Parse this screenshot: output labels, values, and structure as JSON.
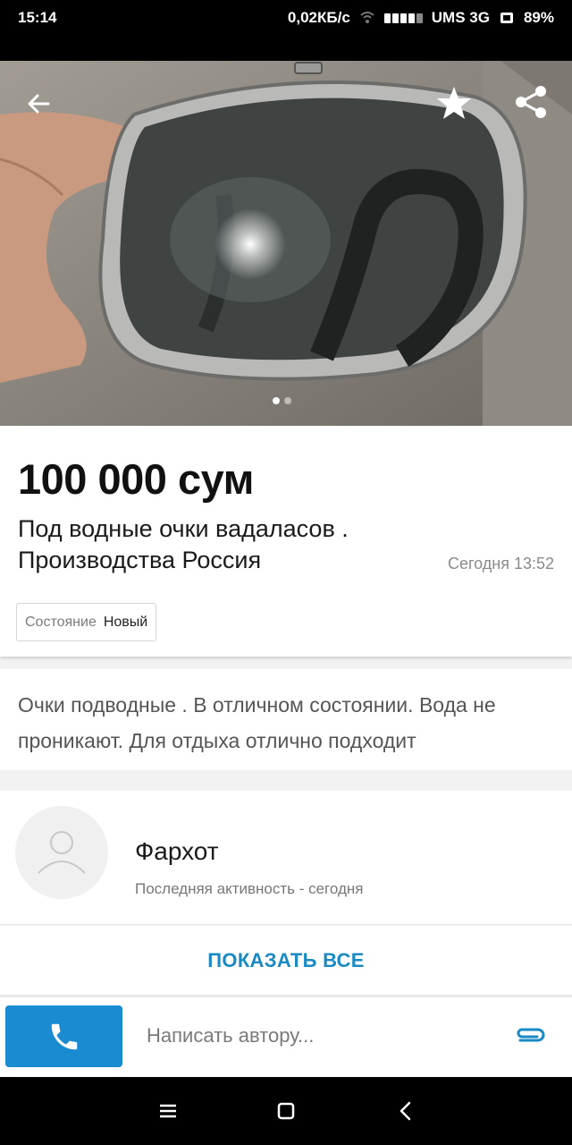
{
  "status_bar": {
    "time": "15:14",
    "speed": "0,02КБ/с",
    "carrier": "UMS 3G",
    "battery": "89%"
  },
  "photo": {
    "slide_count": 2,
    "active_slide": 1
  },
  "listing": {
    "price": "100 000 сум",
    "title": "Под водные очки вадаласов . Производства Россия",
    "date": "Сегодня 13:52",
    "condition_label": "Состояние",
    "condition_value": "Новый",
    "description": "Очки подводные . В отличном состоянии. Вода не проникают. Для отдыха отлично подходит"
  },
  "seller": {
    "name": "Фархот",
    "activity": "Последняя активность - сегодня",
    "show_all": "ПОКАЗАТЬ ВСЕ"
  },
  "composer": {
    "placeholder": "Написать автору..."
  },
  "colors": {
    "accent": "#1b8bd1",
    "link": "#1a8ac4"
  },
  "icons": [
    "back-arrow-icon",
    "star-icon",
    "share-icon",
    "avatar-icon",
    "phone-icon",
    "paperclip-icon",
    "menu-icon",
    "home-icon",
    "back-icon"
  ]
}
